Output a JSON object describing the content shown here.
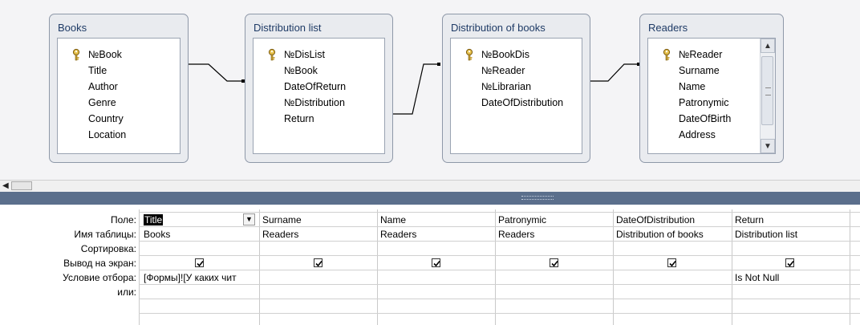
{
  "tables": [
    {
      "title": "Books",
      "fields": [
        "*",
        "№Book",
        "Title",
        "Author",
        "Genre",
        "Country",
        "Location"
      ],
      "key_field": "№Book",
      "scrollbar": false
    },
    {
      "title": "Distribution list",
      "fields": [
        "*",
        "№DisList",
        "№Book",
        "DateOfReturn",
        "№Distribution",
        "Return"
      ],
      "key_field": "№DisList",
      "scrollbar": false
    },
    {
      "title": "Distribution of books",
      "fields": [
        "*",
        "№BookDis",
        "№Reader",
        "№Librarian",
        "DateOfDistribution"
      ],
      "key_field": "№BookDis",
      "scrollbar": false
    },
    {
      "title": "Readers",
      "fields": [
        "*",
        "№Reader",
        "Surname",
        "Name",
        "Patronymic",
        "DateOfBirth",
        "Address"
      ],
      "key_field": "№Reader",
      "scrollbar": true
    }
  ],
  "grid": {
    "row_labels": [
      "Поле:",
      "Имя таблицы:",
      "Сортировка:",
      "Вывод на экран:",
      "Условие отбора:",
      "или:"
    ],
    "columns": [
      {
        "field": "Title",
        "table": "Books",
        "sort": "",
        "show": true,
        "criteria": "[Формы]![У каких чит",
        "or": "",
        "selected": true
      },
      {
        "field": "Surname",
        "table": "Readers",
        "sort": "",
        "show": true,
        "criteria": "",
        "or": ""
      },
      {
        "field": "Name",
        "table": "Readers",
        "sort": "",
        "show": true,
        "criteria": "",
        "or": ""
      },
      {
        "field": "Patronymic",
        "table": "Readers",
        "sort": "",
        "show": true,
        "criteria": "",
        "or": ""
      },
      {
        "field": "DateOfDistribution",
        "table": "Distribution of books",
        "sort": "",
        "show": true,
        "criteria": "",
        "or": ""
      },
      {
        "field": "Return",
        "table": "Distribution list",
        "sort": "",
        "show": true,
        "criteria": "Is Not Null",
        "or": ""
      }
    ]
  },
  "colors": {
    "title_text": "#1f3b66",
    "splitter": "#5b6f8c",
    "pane_bg": "#f4f4f6"
  }
}
